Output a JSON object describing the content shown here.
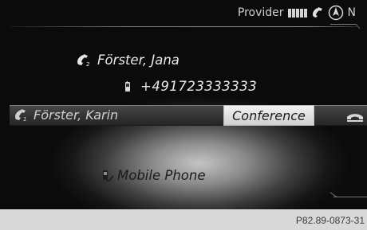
{
  "status_bar": {
    "provider_label": "Provider",
    "signal_bars": 5,
    "phone_icon": "handset-icon",
    "compass_icon": "compass-icon",
    "heading": "N"
  },
  "calls": {
    "second_caller": {
      "icon": "handset-2-icon",
      "index": "2",
      "name": "Förster, Jana"
    },
    "second_number": {
      "icon": "mobile-phone-icon",
      "number": "+491723333333"
    },
    "first_caller": {
      "icon": "handset-1-icon",
      "index": "1",
      "name": "Förster, Karin"
    },
    "conference_label": "Conference",
    "hangup_icon": "hang-up-icon"
  },
  "device": {
    "icon": "bluetooth-phone-icon",
    "name": "Mobile Phone"
  },
  "figure_ref": "P82.89-0873-31"
}
